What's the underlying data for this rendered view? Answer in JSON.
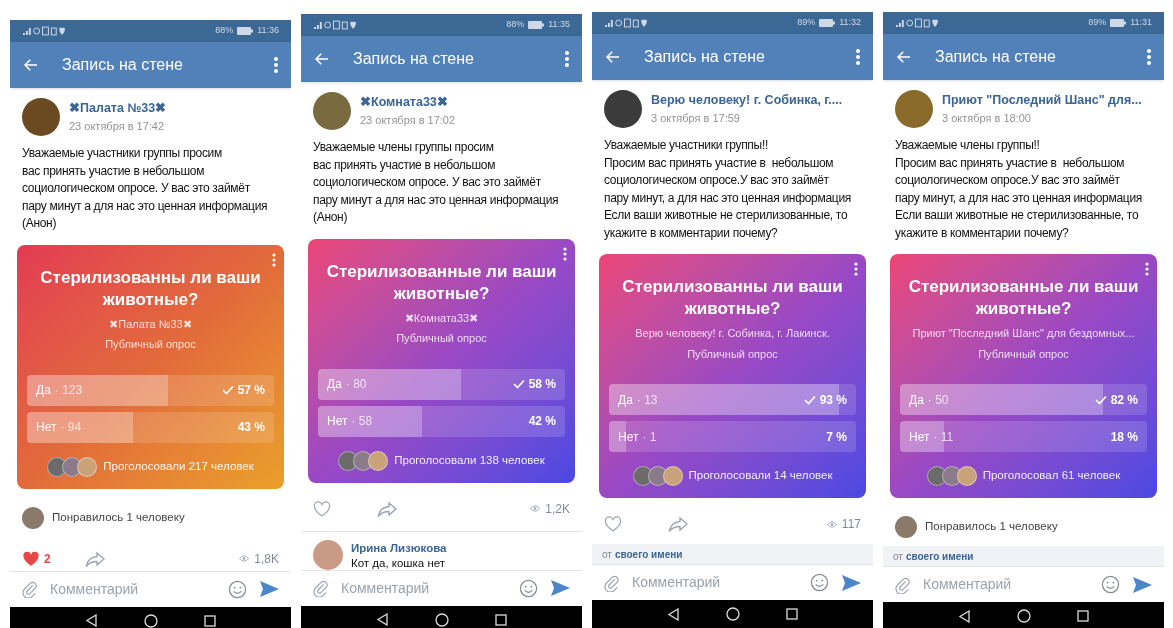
{
  "screens": [
    {
      "status": {
        "battery": "88%",
        "time": "11:36"
      },
      "title": "Запись на стене",
      "post": {
        "author": "✖Палата №33✖",
        "date": "23 октября в 17:42",
        "text": "Уважаемые участники группы просим\nвас принять участие в небольшом\nсоциологическом опросе. У вас это займёт\nпару минут а для нас это ценная информация\n(Анон)"
      },
      "poll": {
        "kind": "sunset",
        "title": "Стерилизованны ли ваши\nживотные?",
        "author": "✖Палата №33✖",
        "subtitle": "Публичный опрос",
        "options": [
          {
            "label": "Да",
            "count": "· 123",
            "percent": "57 %",
            "level": 0.57,
            "selected": true
          },
          {
            "label": "Нет",
            "count": "· 94",
            "percent": "43 %",
            "level": 0.43,
            "selected": false
          }
        ],
        "voters": "Проголосовали 217 человек"
      },
      "liked_by": "Понравилось 1 человеку",
      "actions": {
        "liked": true,
        "likes": "2",
        "views": "1,8K"
      },
      "comment_field": {
        "placeholder": "Комментарий"
      }
    },
    {
      "status": {
        "battery": "88%",
        "time": "11:35"
      },
      "title": "Запись на стене",
      "post": {
        "author": "✖Комната33✖",
        "date": "23 октября в 17:02",
        "text": "Уважаемые члены группы просим\nвас принять участие в небольшом\nсоциологическом опросе. У вас это займёт\nпару минут а для нас это ценная информация\n(Анон)"
      },
      "poll": {
        "kind": "violet",
        "title": "Стерилизованные ли ваши\nживотные?",
        "author": "✖Комната33✖",
        "subtitle": "Публичный опрос",
        "options": [
          {
            "label": "Да",
            "count": "· 80",
            "percent": "58 %",
            "level": 0.58,
            "selected": true
          },
          {
            "label": "Нет",
            "count": "· 58",
            "percent": "42 %",
            "level": 0.42,
            "selected": false
          }
        ],
        "voters": "Проголосовали 138 человек"
      },
      "actions": {
        "liked": false,
        "views": "1,2K"
      },
      "comment": {
        "author": "Ирина Лизюкова",
        "text": "Кот да, кошка нет"
      },
      "comment_field": {
        "placeholder": "Комментарий"
      }
    },
    {
      "status": {
        "battery": "89%",
        "time": "11:32"
      },
      "title": "Запись на стене",
      "post": {
        "author": "Верю человеку! г. Собинка, г....",
        "date": "3 октября в 17:59",
        "text": "Уважаемые участники группы!!\nПросим вас принять участие в  небольшом\nсоциологическом опросе.У вас это займёт\nпару минут, а для нас это ценная информация\nЕсли ваши животные не стерилизованные, то\nукажите в комментарии почему?"
      },
      "poll": {
        "kind": "violet",
        "title": "Стерилизованны ли ваши\nживотные?",
        "author": "Верю человеку! г. Собинка, г. Лакинск.",
        "subtitle": "Публичный опрос",
        "options": [
          {
            "label": "Да",
            "count": "· 13",
            "percent": "93 %",
            "level": 0.93,
            "selected": true
          },
          {
            "label": "Нет",
            "count": "· 1",
            "percent": "7 %",
            "level": 0.07,
            "selected": false
          }
        ],
        "voters": "Проголосовали 14 человек"
      },
      "actions": {
        "liked": false,
        "views": "117"
      },
      "sender": {
        "prefix": "от",
        "name": "своего имени"
      },
      "comment_field": {
        "placeholder": "Комментарий"
      }
    },
    {
      "status": {
        "battery": "89%",
        "time": "11:31"
      },
      "title": "Запись на стене",
      "post": {
        "author": "Приют \"Последний Шанс\" для...",
        "date": "3 октября в 18:00",
        "text": "Уважаемые члены группы!!\nПросим вас принять участие в  небольшом\nсоциологическом опросе.У вас это займёт\nпару минут, а для нас это ценная информация\nЕсли ваши животные не стерилизованные, то\nукажите в комментарии почему?"
      },
      "poll": {
        "kind": "violet",
        "title": "Стерилизованные ли ваши\nживотные?",
        "author": "Приют \"Последний Шанс\" для бездомных...",
        "subtitle": "Публичный опрос",
        "options": [
          {
            "label": "Да",
            "count": "· 50",
            "percent": "82 %",
            "level": 0.82,
            "selected": true
          },
          {
            "label": "Нет",
            "count": "· 11",
            "percent": "18 %",
            "level": 0.18,
            "selected": false
          }
        ],
        "voters": "Проголосовал 61 человек"
      },
      "liked_by": "Понравилось 1 человеку",
      "sender": {
        "prefix": "от",
        "name": "своего имени"
      },
      "comment_field": {
        "placeholder": "Комментарий"
      }
    }
  ]
}
